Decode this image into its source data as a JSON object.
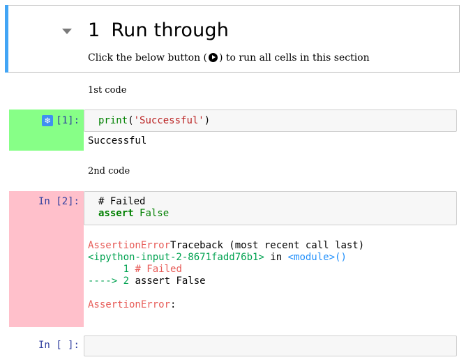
{
  "section": {
    "number": "1",
    "title": "Run through",
    "desc_before": "Click the below button (",
    "desc_after": ") to run all cells in this section"
  },
  "cells": {
    "md1": "1st code",
    "code1": {
      "prompt": "[1]:",
      "fn": "print",
      "open": "(",
      "arg": "'Successful'",
      "close": ")",
      "output": "Successful"
    },
    "md2": "2nd code",
    "code2": {
      "prompt": "In [2]:",
      "comment": "# Failed",
      "keyword": "assert",
      "value": "False",
      "tb_line1_err": "AssertionError",
      "tb_line1_rest": "Traceback (most recent call last)",
      "tb_line2_input": "<ipython-input-2-8671fadd76b1>",
      "tb_line2_in": " in ",
      "tb_line2_module": "<module>",
      "tb_line2_parens": "()",
      "tb_line3_num": "      1 ",
      "tb_line3_comment": "# Failed",
      "tb_line4_arrow": "----> 2 ",
      "tb_line4_code": "assert False",
      "tb_final": "AssertionError",
      "tb_final_colon": ":"
    },
    "code3": {
      "prompt": "In [ ]:"
    }
  },
  "colors": {
    "accent": "#42a5f5",
    "success_prompt_bg": "#87ff87",
    "error_prompt_bg": "#ffc0cb",
    "error_text": "#e75c58"
  },
  "icons": [
    "collapse-triangle-icon",
    "run-all-button-icon",
    "freeze-snowflake-icon"
  ]
}
